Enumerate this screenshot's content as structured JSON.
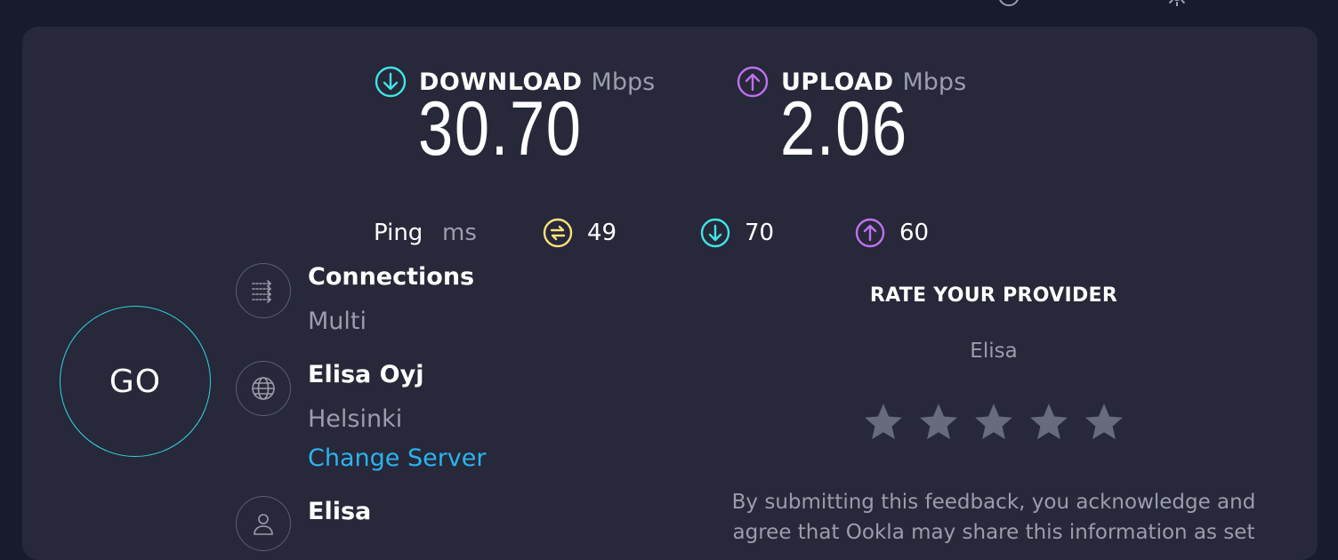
{
  "header": {
    "icons": [
      "history-icon",
      "settings-icon"
    ]
  },
  "download": {
    "label": "DOWNLOAD",
    "unit": "Mbps",
    "value": "30.70",
    "icon": "download-arrow-icon",
    "color": "#3ee6e6"
  },
  "upload": {
    "label": "UPLOAD",
    "unit": "Mbps",
    "value": "2.06",
    "icon": "upload-arrow-icon",
    "color": "#bf71f2"
  },
  "ping": {
    "label": "Ping",
    "unit": "ms",
    "idle": "49",
    "download": "70",
    "upload": "60",
    "idle_color": "#fbe27b"
  },
  "go_button": {
    "label": "GO",
    "ring_color": "#2fd4e0"
  },
  "connections": {
    "title": "Connections",
    "value": "Multi"
  },
  "server": {
    "name": "Elisa Oyj",
    "location": "Helsinki",
    "change_label": "Change Server",
    "link_color": "#2ab4f0"
  },
  "provider": {
    "name": "Elisa"
  },
  "rate": {
    "title": "RATE YOUR PROVIDER",
    "provider": "Elisa",
    "star_count": 5,
    "disclaimer": "By submitting this feedback, you acknowledge and agree that Ookla may share this information as set"
  }
}
